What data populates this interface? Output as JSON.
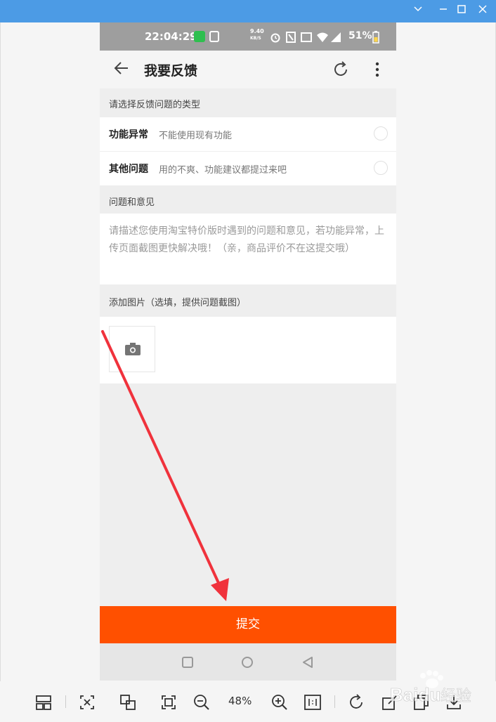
{
  "status_bar": {
    "time": "22:04:29",
    "speed": "9.40",
    "speed_unit": "KB/S",
    "battery": "51%"
  },
  "app_bar": {
    "title": "我要反馈"
  },
  "sections": {
    "type_label": "请选择反馈问题的类型",
    "feedback_label": "问题和意见",
    "image_label": "添加图片（选填，提供问题截图）"
  },
  "options": [
    {
      "title": "功能异常",
      "desc": "不能使用现有功能"
    },
    {
      "title": "其他问题",
      "desc": "用的不爽、功能建议都提过来吧"
    }
  ],
  "feedback": {
    "placeholder": "请描述您使用淘宝特价版时遇到的问题和意见，若功能异常，上传页面截图更快解决哦！（亲，商品评价不在这提交哦）"
  },
  "submit_label": "提交",
  "viewer_toolbar": {
    "zoom": "48%"
  },
  "watermark": "Baidu 经验",
  "colors": {
    "titlebar": "#4c9be5",
    "submit": "#ff5000",
    "arrow": "#f0323c"
  }
}
